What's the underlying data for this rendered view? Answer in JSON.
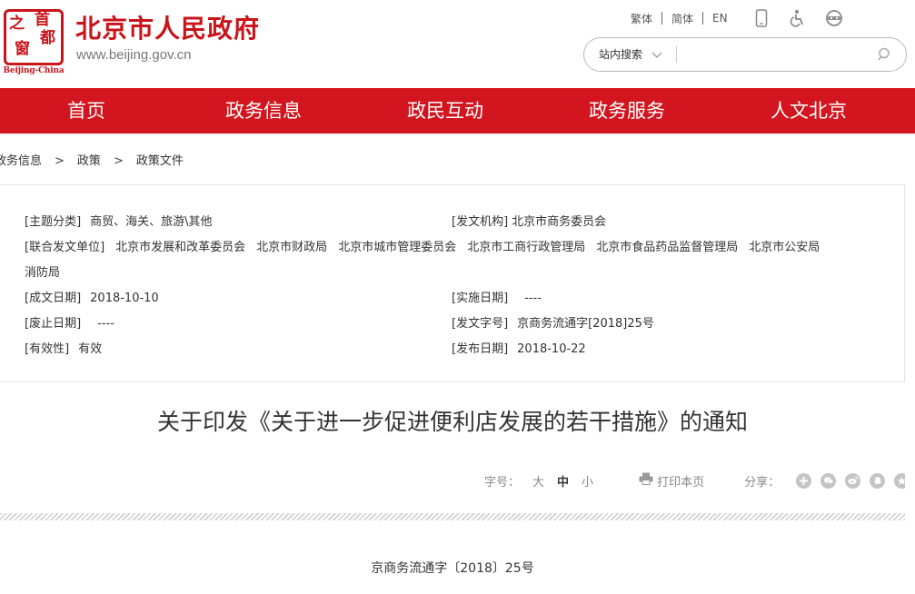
{
  "header": {
    "logo": {
      "glyphs": [
        "之",
        "首",
        "都",
        "窗"
      ],
      "caption": "Beijing-China"
    },
    "site_title": "北京市人民政府",
    "site_url": "www.beijing.gov.cn",
    "lang": {
      "traditional": "繁体",
      "simplified": "简体",
      "english": "EN"
    },
    "search": {
      "scope": "站内搜索",
      "placeholder": ""
    }
  },
  "nav": [
    {
      "label": "首页"
    },
    {
      "label": "政务信息"
    },
    {
      "label": "政民互动"
    },
    {
      "label": "政务服务"
    },
    {
      "label": "人文北京"
    }
  ],
  "breadcrumb": [
    "政务信息",
    "政策",
    "政策文件"
  ],
  "meta": {
    "topic_key": "[主题分类]",
    "topic_val": "商贸、海关、旅游\\其他",
    "issuer_key": "[发文机构]",
    "issuer_val": "北京市商务委员会",
    "joint_key": "[联合发文单位]",
    "joint_orgs": [
      "北京市发展和改革委员会",
      "北京市财政局",
      "北京市城市管理委员会",
      "北京市工商行政管理局",
      "北京市食品药品监督管理局",
      "北京市公安局"
    ],
    "joint_wrap": "消防局",
    "created_key": "[成文日期]",
    "created_val": "2018-10-10",
    "effective_key": "[实施日期]",
    "effective_val": "----",
    "abolish_key": "[废止日期]",
    "abolish_val": "----",
    "docno_key": "[发文字号]",
    "docno_val": "京商务流通字[2018]25号",
    "validity_key": "[有效性]",
    "validity_val": "有效",
    "publish_key": "[发布日期]",
    "publish_val": "2018-10-22"
  },
  "title": "关于印发《关于进一步促进便利店发展的若干措施》的通知",
  "tools": {
    "font_label": "字号：",
    "size_large": "大",
    "size_medium": "中",
    "size_small": "小",
    "print_label": "打印本页",
    "share_label": "分享："
  },
  "doc_number": "京商务流通字〔2018〕25号",
  "colors": {
    "brand_red": "#d2151e",
    "title_red": "#c9141b"
  }
}
